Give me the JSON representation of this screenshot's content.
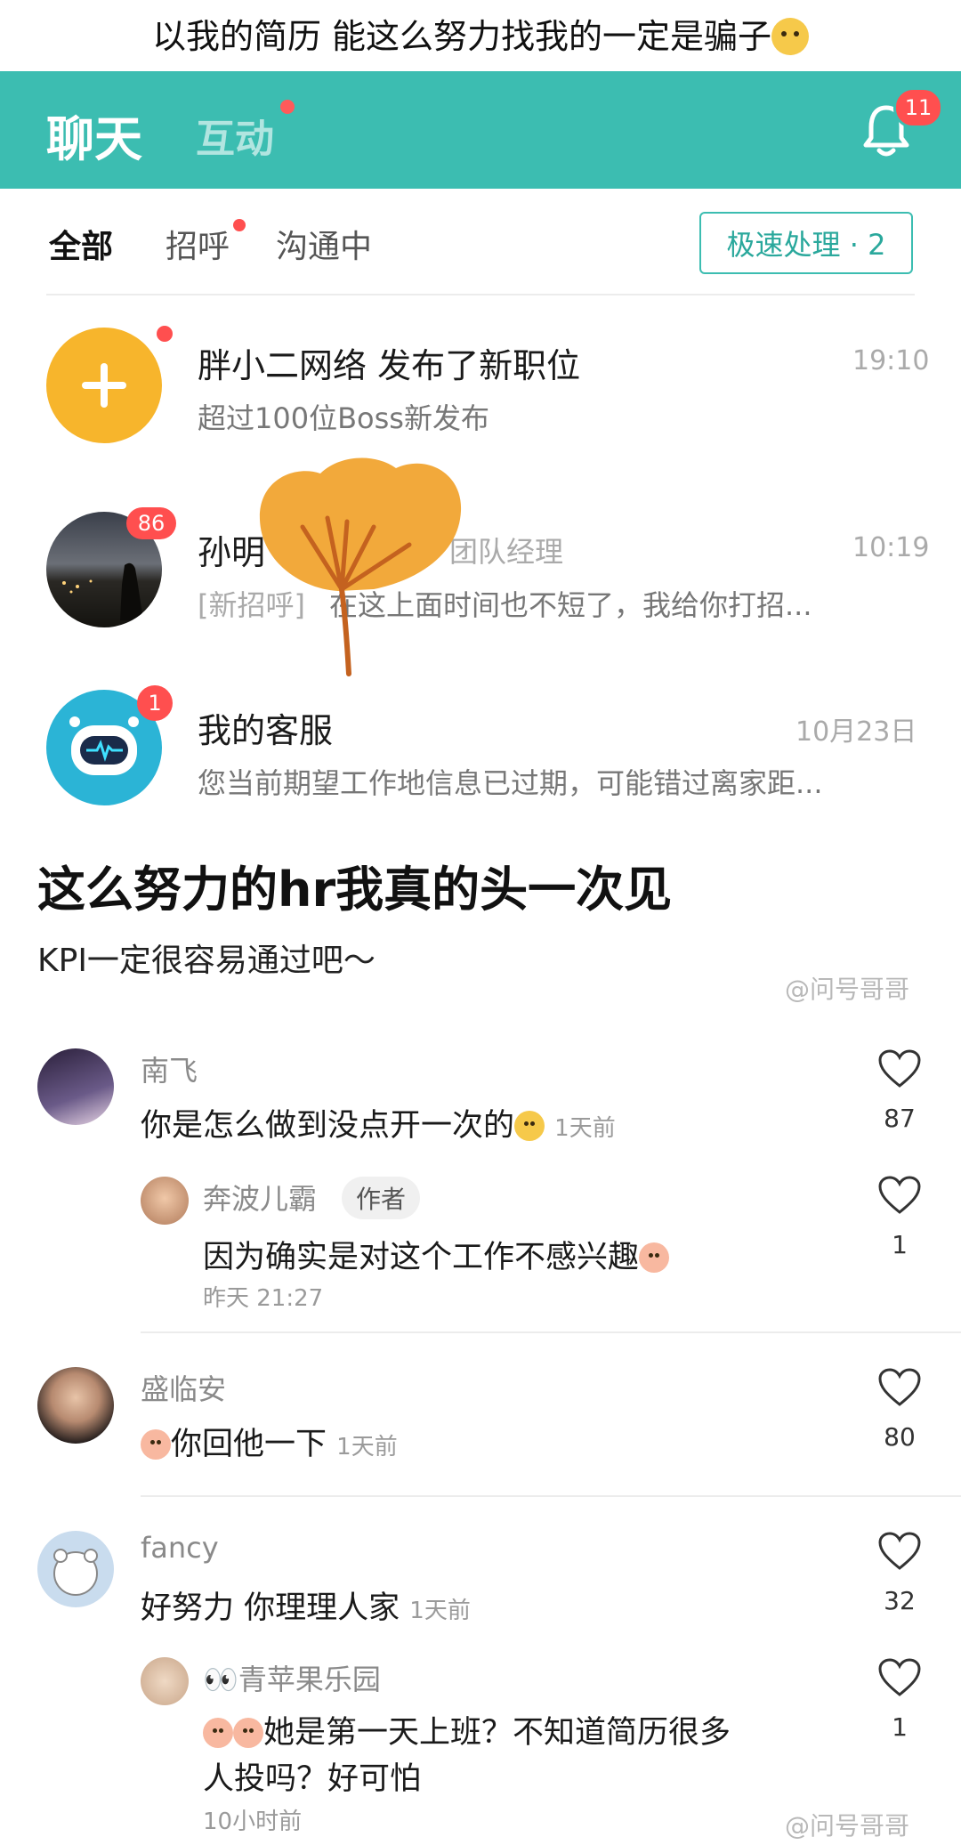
{
  "caption": "以我的简历 能这么努力找我的一定是骗子",
  "app": {
    "tab_chat": "聊天",
    "tab_interact": "互动",
    "bell_badge": "11",
    "accent_color": "#3cbdb1"
  },
  "filters": {
    "all": "全部",
    "greeting": "招呼",
    "communicating": "沟通中",
    "fast_process": "极速处理 · 2"
  },
  "chats": [
    {
      "title": "胖小二网络 发布了新职位",
      "subtitle": "超过100位Boss新发布",
      "time": "19:10",
      "avatar_icon": "plus-icon"
    },
    {
      "title_a": "孙明",
      "title_b": "团队经理",
      "subtitle_a": "[新招呼]",
      "subtitle_b": "在这上面时间也不短了，我给你打招...",
      "time": "10:19",
      "badge": "86",
      "avatar_icon": "night-skyline-photo"
    },
    {
      "title": "我的客服",
      "subtitle": "您当前期望工作地信息已过期，可能错过离家距...",
      "time": "10月23日",
      "badge": "1",
      "avatar_icon": "robot-icon"
    }
  ],
  "post": {
    "title": "这么努力的hr我真的头一次见",
    "subtitle": "KPI一定很容易通过吧～",
    "watermark": "@问号哥哥"
  },
  "comments": [
    {
      "name": "南飞",
      "text": "你是怎么做到没点开一次的",
      "time": "1天前",
      "likes": "87"
    },
    {
      "name": "奔波儿霸",
      "tag": "作者",
      "text": "因为确实是对这个工作不感兴趣",
      "time": "昨天 21:27",
      "likes": "1"
    },
    {
      "name": "盛临安",
      "text": "你回他一下",
      "time": "1天前",
      "likes": "80"
    },
    {
      "name": "fancy",
      "text": "好努力 你理理人家",
      "time": "1天前",
      "likes": "32"
    },
    {
      "name": "👀青苹果乐园",
      "text_line1": "她是第一天上班？不知道简历很多",
      "text_line2": "人投吗？好可怕",
      "time": "10小时前",
      "likes": "1"
    }
  ],
  "watermark_bottom": "@问号哥哥"
}
